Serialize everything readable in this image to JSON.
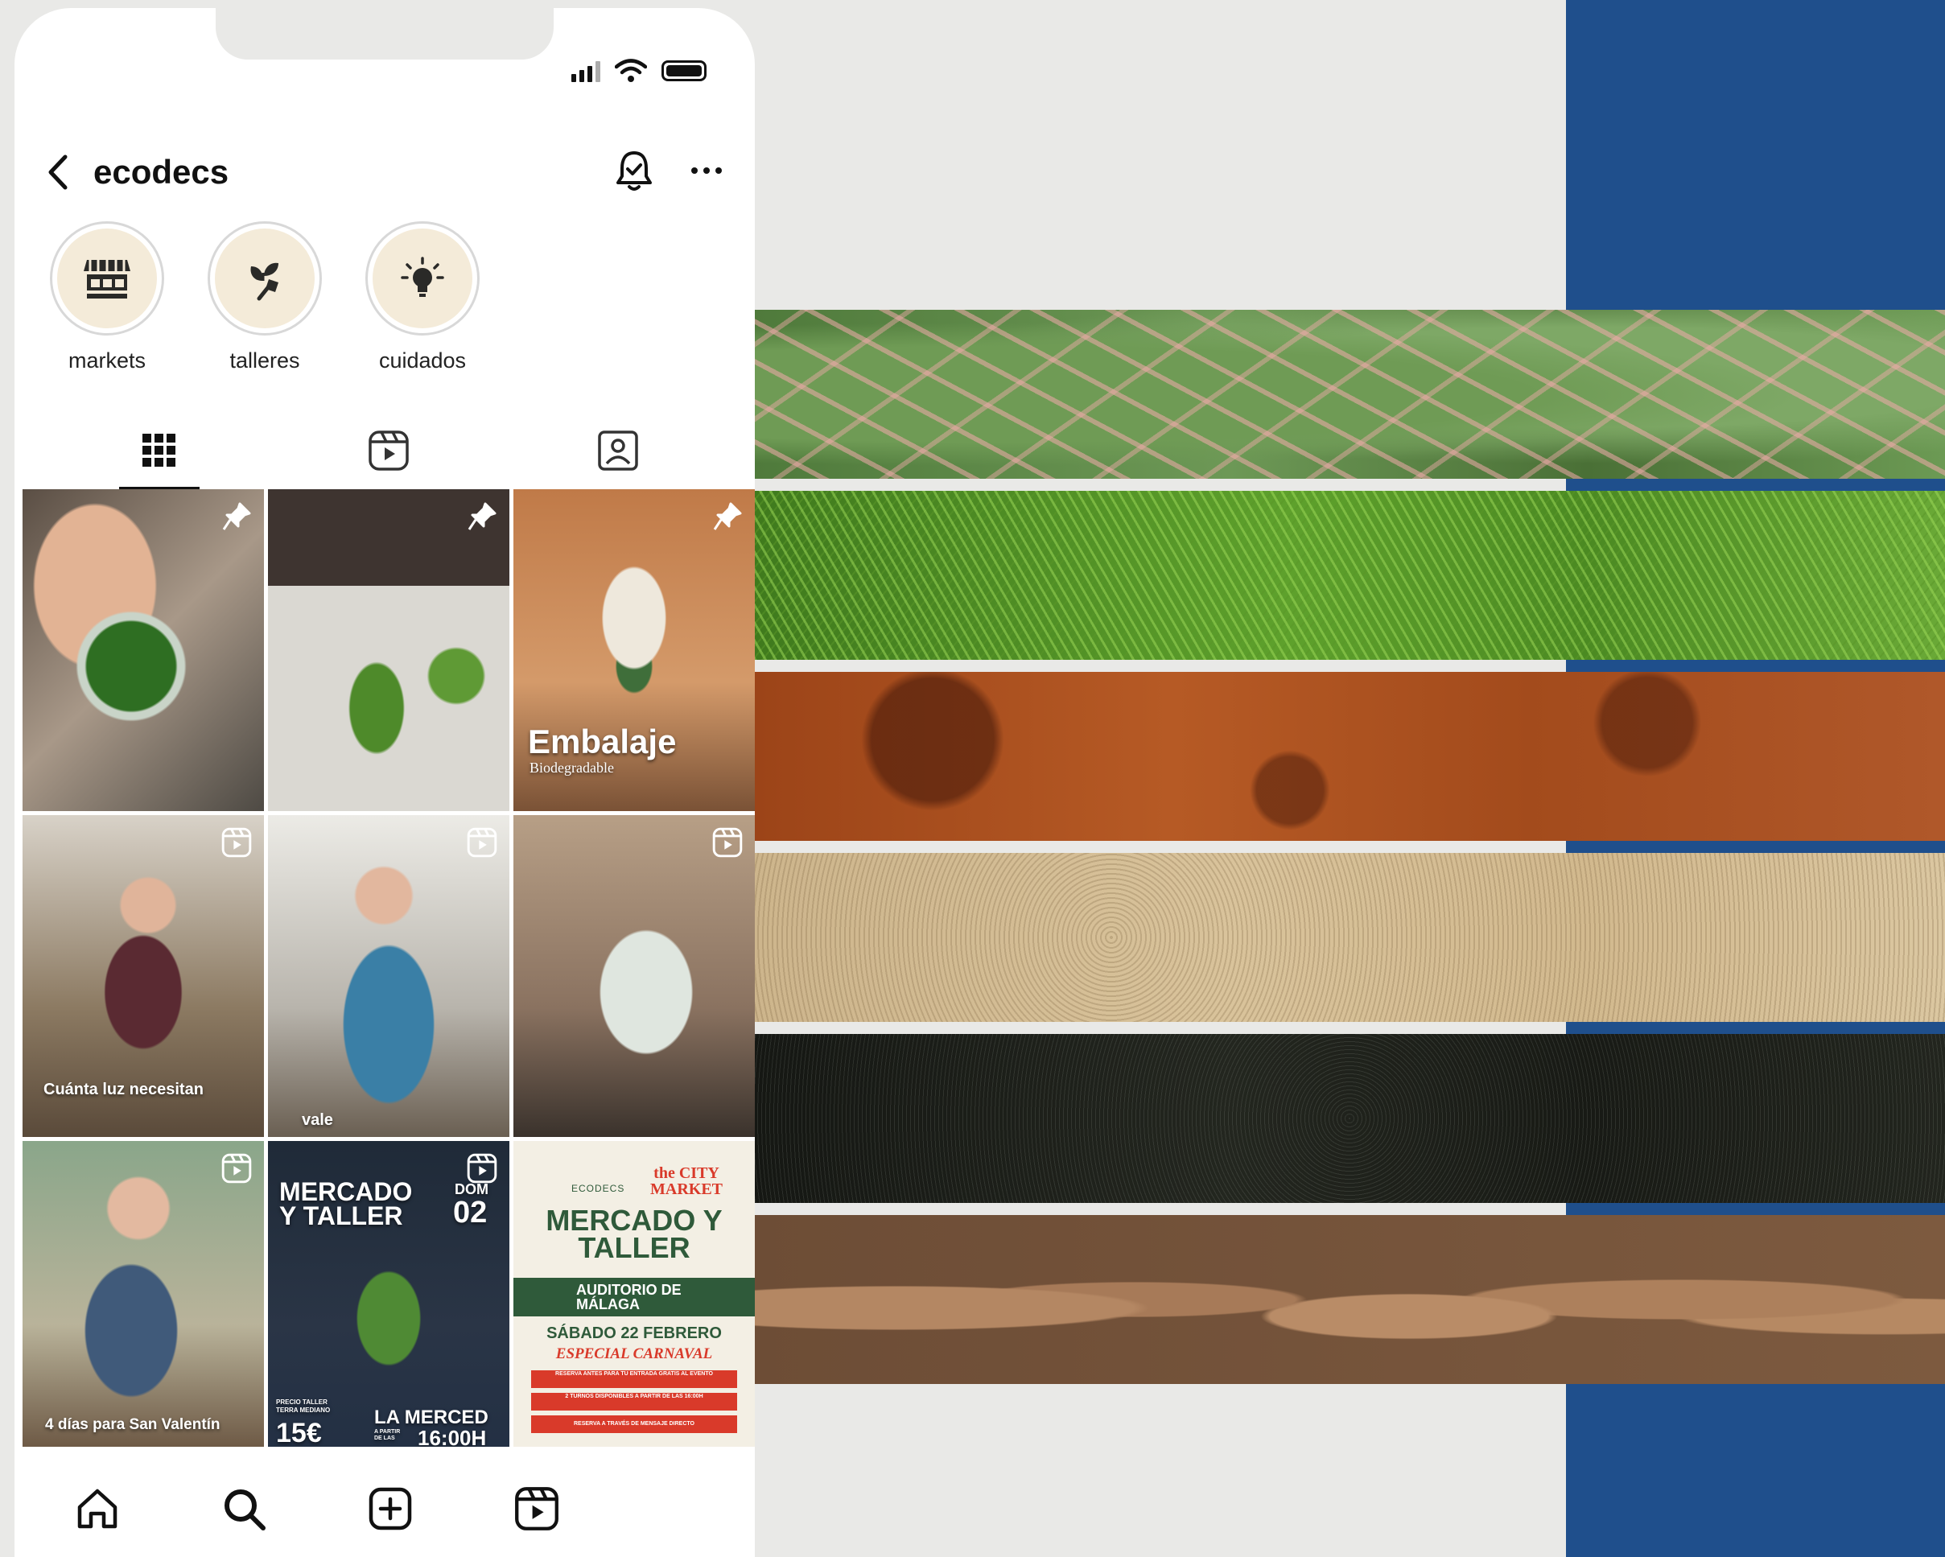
{
  "profile": {
    "username": "ecodecs"
  },
  "highlights": [
    {
      "label": "markets",
      "icon": "market-stall-icon"
    },
    {
      "label": "talleres",
      "icon": "plant-shovel-icon"
    },
    {
      "label": "cuidados",
      "icon": "lightbulb-icon"
    }
  ],
  "tabs": [
    {
      "name": "posts-grid",
      "icon": "grid-icon",
      "active": true
    },
    {
      "name": "reels",
      "icon": "reels-icon",
      "active": false
    },
    {
      "name": "tagged",
      "icon": "tagged-person-icon",
      "active": false
    }
  ],
  "posts": [
    {
      "badge": "pin-icon",
      "caption": ""
    },
    {
      "badge": "pin-icon",
      "caption": ""
    },
    {
      "badge": "pin-icon",
      "caption": "Embalaje",
      "subcaption": "Biodegradable"
    },
    {
      "badge": "reel-icon",
      "caption": "Cuánta luz necesitan"
    },
    {
      "badge": "reel-icon",
      "caption": "vale"
    },
    {
      "badge": "reel-icon",
      "caption": ""
    },
    {
      "badge": "reel-icon",
      "caption": "4 días para San Valentín"
    },
    {
      "badge": "reel-icon",
      "caption": "MERCADO Y TALLER",
      "day_label": "DOM",
      "day_number": "02",
      "price_label": "PRECIO TALLER TERRA MEDIANO",
      "price": "15€",
      "venue": "LA MERCED",
      "time_label": "A PARTIR DE LAS",
      "time": "16:00H"
    },
    {
      "badge": "",
      "brand": "ECODECS",
      "market_brand": "the CITY MARKET",
      "title": "MERCADO Y TALLER",
      "venue": "AUDITORIO DE MÁLAGA",
      "date": "SÁBADO 22 FEBRERO",
      "special": "ESPECIAL CARNAVAL",
      "notes": [
        "RESERVA ANTES PARA TU ENTRADA GRATIS AL EVENTO",
        "2 TURNOS DISPONIBLES A PARTIR DE LAS 16:00H",
        "RESERVA A TRAVÉS DE MENSAJE DIRECTO"
      ]
    }
  ],
  "bottom_nav": [
    {
      "name": "home",
      "icon": "home-icon"
    },
    {
      "name": "search",
      "icon": "search-icon"
    },
    {
      "name": "create",
      "icon": "add-square-icon"
    },
    {
      "name": "reels",
      "icon": "reels-icon"
    }
  ],
  "colors": {
    "background": "#e9e9e7",
    "blue_panel": "#1f4f8c",
    "highlight_fill": "#f4ebd9",
    "event_green": "#2f5a3a",
    "event_red": "#d93a2a"
  }
}
